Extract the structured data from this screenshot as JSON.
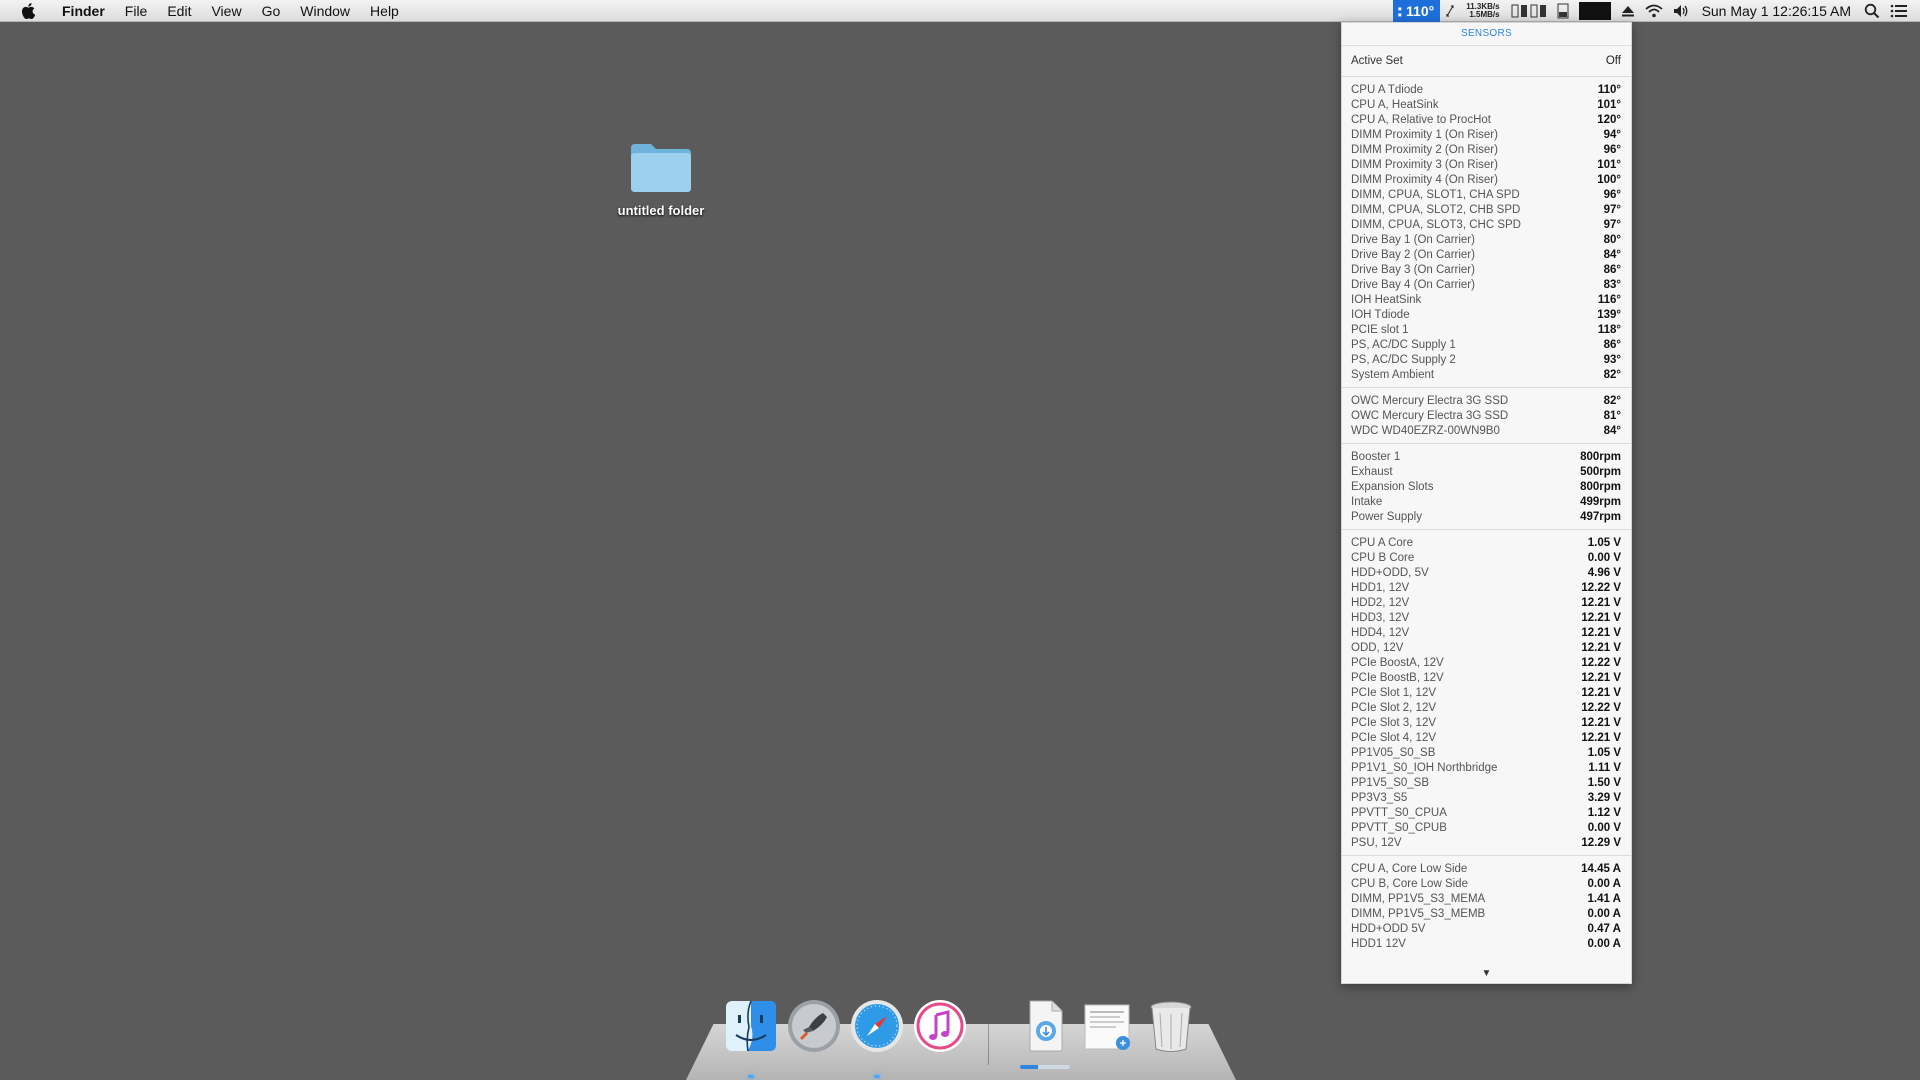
{
  "menubar": {
    "app_name": "Finder",
    "items": [
      "File",
      "Edit",
      "View",
      "Go",
      "Window",
      "Help"
    ],
    "temp_badge": "110°",
    "net_up": "11.3KB/s",
    "net_down": "1.5MB/s",
    "clock": "Sun May 1  12:26:15 AM"
  },
  "desktop": {
    "folder_label": "untitled folder"
  },
  "sensors_panel": {
    "title": "SENSORS",
    "active_set": {
      "label": "Active Set",
      "value": "Off"
    },
    "sections": [
      {
        "rows": [
          {
            "name": "CPU A Tdiode",
            "value": "110°"
          },
          {
            "name": "CPU A, HeatSink",
            "value": "101°"
          },
          {
            "name": "CPU A, Relative to ProcHot",
            "value": "120°"
          },
          {
            "name": "DIMM Proximity 1 (On Riser)",
            "value": "94°"
          },
          {
            "name": "DIMM Proximity 2 (On Riser)",
            "value": "96°"
          },
          {
            "name": "DIMM Proximity 3 (On Riser)",
            "value": "101°"
          },
          {
            "name": "DIMM Proximity 4 (On Riser)",
            "value": "100°"
          },
          {
            "name": "DIMM, CPUA, SLOT1, CHA SPD",
            "value": "96°"
          },
          {
            "name": "DIMM, CPUA, SLOT2, CHB SPD",
            "value": "97°"
          },
          {
            "name": "DIMM, CPUA, SLOT3, CHC SPD",
            "value": "97°"
          },
          {
            "name": "Drive Bay 1 (On Carrier)",
            "value": "80°"
          },
          {
            "name": "Drive Bay 2 (On Carrier)",
            "value": "84°"
          },
          {
            "name": "Drive Bay 3 (On Carrier)",
            "value": "86°"
          },
          {
            "name": "Drive Bay 4 (On Carrier)",
            "value": "83°"
          },
          {
            "name": "IOH HeatSink",
            "value": "116°"
          },
          {
            "name": "IOH Tdiode",
            "value": "139°"
          },
          {
            "name": "PCIE slot 1",
            "value": "118°"
          },
          {
            "name": "PS, AC/DC Supply 1",
            "value": "86°"
          },
          {
            "name": "PS, AC/DC Supply 2",
            "value": "93°"
          },
          {
            "name": "System Ambient",
            "value": "82°"
          }
        ]
      },
      {
        "rows": [
          {
            "name": "OWC Mercury Electra 3G SSD",
            "value": "82°"
          },
          {
            "name": "OWC Mercury Electra 3G SSD",
            "value": "81°"
          },
          {
            "name": "WDC WD40EZRZ-00WN9B0",
            "value": "84°"
          }
        ]
      },
      {
        "rows": [
          {
            "name": "Booster 1",
            "value": "800rpm"
          },
          {
            "name": "Exhaust",
            "value": "500rpm"
          },
          {
            "name": "Expansion Slots",
            "value": "800rpm"
          },
          {
            "name": "Intake",
            "value": "499rpm"
          },
          {
            "name": "Power Supply",
            "value": "497rpm"
          }
        ]
      },
      {
        "rows": [
          {
            "name": "CPU A Core",
            "value": "1.05 V"
          },
          {
            "name": "CPU B Core",
            "value": "0.00 V"
          },
          {
            "name": "HDD+ODD, 5V",
            "value": "4.96 V"
          },
          {
            "name": "HDD1, 12V",
            "value": "12.22 V"
          },
          {
            "name": "HDD2, 12V",
            "value": "12.21 V"
          },
          {
            "name": "HDD3, 12V",
            "value": "12.21 V"
          },
          {
            "name": "HDD4, 12V",
            "value": "12.21 V"
          },
          {
            "name": "ODD, 12V",
            "value": "12.21 V"
          },
          {
            "name": "PCIe BoostA, 12V",
            "value": "12.22 V"
          },
          {
            "name": "PCIe BoostB, 12V",
            "value": "12.21 V"
          },
          {
            "name": "PCIe Slot 1, 12V",
            "value": "12.21 V"
          },
          {
            "name": "PCIe Slot 2, 12V",
            "value": "12.22 V"
          },
          {
            "name": "PCIe Slot 3, 12V",
            "value": "12.21 V"
          },
          {
            "name": "PCIe Slot 4, 12V",
            "value": "12.21 V"
          },
          {
            "name": "PP1V05_S0_SB",
            "value": "1.05 V"
          },
          {
            "name": "PP1V1_S0_IOH Northbridge",
            "value": "1.11 V"
          },
          {
            "name": "PP1V5_S0_SB",
            "value": "1.50 V"
          },
          {
            "name": "PP3V3_S5",
            "value": "3.29 V"
          },
          {
            "name": "PPVTT_S0_CPUA",
            "value": "1.12 V"
          },
          {
            "name": "PPVTT_S0_CPUB",
            "value": "0.00 V"
          },
          {
            "name": "PSU, 12V",
            "value": "12.29 V"
          }
        ]
      },
      {
        "rows": [
          {
            "name": "CPU A, Core Low Side",
            "value": "14.45 A"
          },
          {
            "name": "CPU B, Core Low Side",
            "value": "0.00 A"
          },
          {
            "name": "DIMM, PP1V5_S3_MEMA",
            "value": "1.41 A"
          },
          {
            "name": "DIMM, PP1V5_S3_MEMB",
            "value": "0.00 A"
          },
          {
            "name": "HDD+ODD 5V",
            "value": "0.47 A"
          },
          {
            "name": "HDD1 12V",
            "value": "0.00 A"
          }
        ]
      }
    ]
  },
  "dock": {
    "items": [
      "finder-icon",
      "launchpad-icon",
      "safari-icon",
      "itunes-icon",
      "downloads-stack-icon",
      "document-stack-icon",
      "trash-icon"
    ],
    "download_progress": 0.35
  }
}
